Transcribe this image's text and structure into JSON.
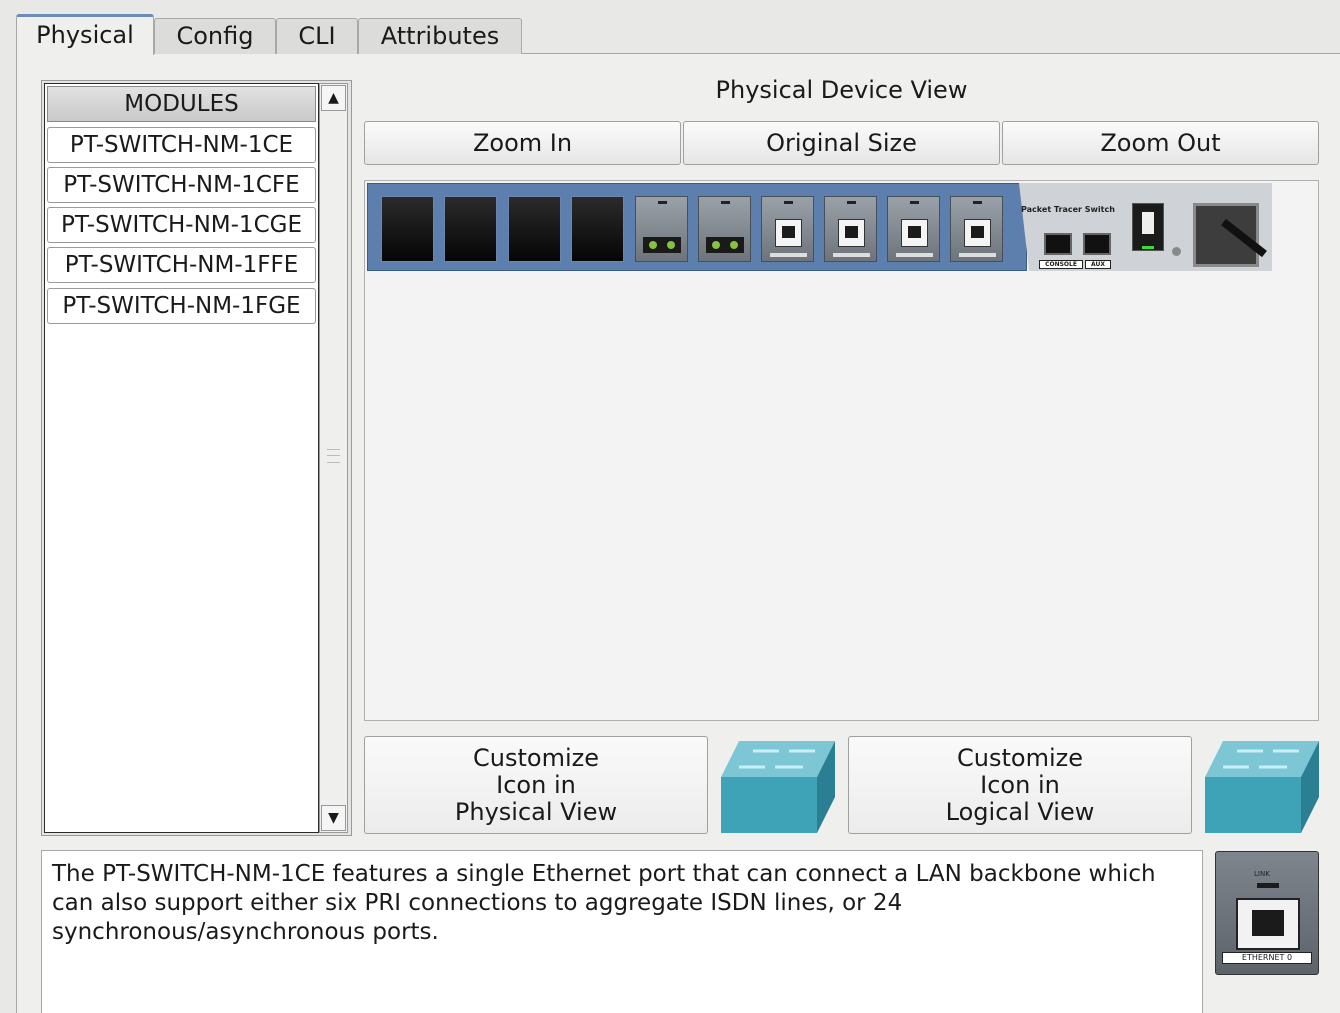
{
  "tabs": [
    "Physical",
    "Config",
    "CLI",
    "Attributes"
  ],
  "modules": {
    "header": "MODULES",
    "items": [
      "PT-SWITCH-NM-1CE",
      "PT-SWITCH-NM-1CFE",
      "PT-SWITCH-NM-1CGE",
      "PT-SWITCH-NM-1FFE",
      "PT-SWITCH-NM-1FGE"
    ]
  },
  "physical_view": {
    "title": "Physical Device View",
    "zoom_in": "Zoom In",
    "original_size": "Original Size",
    "zoom_out": "Zoom Out"
  },
  "device": {
    "label": "Packet Tracer Switch",
    "console_label": "CONSOLE",
    "aux_label": "AUX"
  },
  "customize": {
    "physical": [
      "Customize",
      "Icon in",
      "Physical View"
    ],
    "logical": [
      "Customize",
      "Icon in",
      "Logical View"
    ]
  },
  "description": "The PT-SWITCH-NM-1CE features a single Ethernet port that can connect a LAN backbone which can also support either six PRI connections to aggregate ISDN lines, or 24 synchronous/asynchronous ports.",
  "port_image": {
    "link_label": "LINK",
    "port_label": "ETHERNET 0"
  },
  "colors": {
    "device_blue": "#5d7fae",
    "switch_icon": "#3fa3b8",
    "tab_accent": "#6a8db8"
  }
}
